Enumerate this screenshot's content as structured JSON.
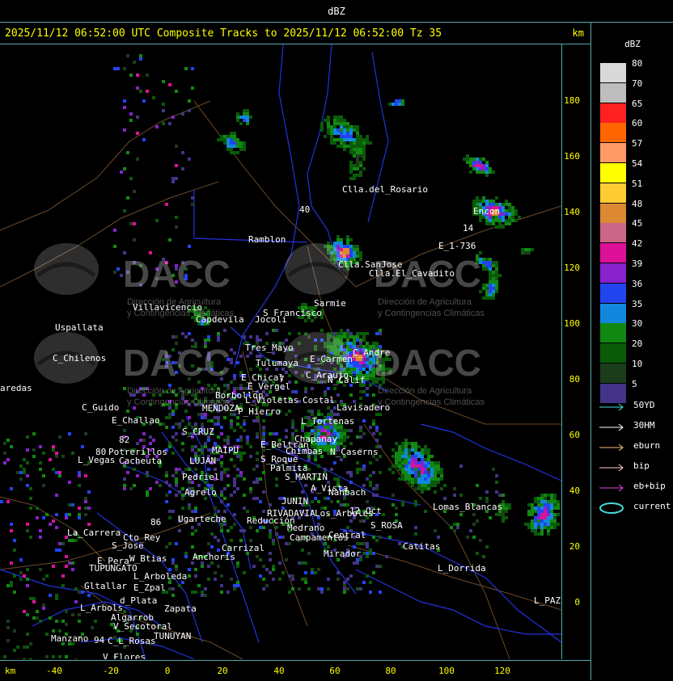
{
  "window": {
    "title": "dBZ"
  },
  "header": {
    "title": "2025/11/12 06:52:00 UTC Composite Tracks to 2025/11/12 06:52:00 Tz 35",
    "unit": "km"
  },
  "axes": {
    "x_unit": "km",
    "y_unit": "km",
    "x_ticks": [
      "-40",
      "-20",
      "0",
      "20",
      "40",
      "60",
      "80",
      "100",
      "120"
    ],
    "y_ticks": [
      "180",
      "160",
      "140",
      "120",
      "100",
      "80",
      "60",
      "40",
      "20",
      "0"
    ]
  },
  "legend": {
    "title": "dBZ",
    "levels": [
      {
        "label": "80",
        "color": "#d9d9d9"
      },
      {
        "label": "70",
        "color": "#bdbdbd"
      },
      {
        "label": "65",
        "color": "#ff2020"
      },
      {
        "label": "60",
        "color": "#ff6600"
      },
      {
        "label": "57",
        "color": "#ff9966"
      },
      {
        "label": "54",
        "color": "#ffff00"
      },
      {
        "label": "51",
        "color": "#ffcc33"
      },
      {
        "label": "48",
        "color": "#dd8833"
      },
      {
        "label": "45",
        "color": "#cc6688"
      },
      {
        "label": "42",
        "color": "#dd1199"
      },
      {
        "label": "39",
        "color": "#8822cc"
      },
      {
        "label": "36",
        "color": "#2244ee"
      },
      {
        "label": "35",
        "color": "#1188dd"
      },
      {
        "label": "30",
        "color": "#118811"
      },
      {
        "label": "20",
        "color": "#0a5a0a"
      },
      {
        "label": "10",
        "color": "#1c3d1c"
      },
      {
        "label": "5",
        "color": "#443388"
      }
    ]
  },
  "tracks": [
    {
      "label": "50YD",
      "color": "#44dddd",
      "kind": "arrow"
    },
    {
      "label": "30HM",
      "color": "#ffffff",
      "kind": "arrow"
    },
    {
      "label": "eburn",
      "color": "#eebb77",
      "kind": "arrow"
    },
    {
      "label": "bip",
      "color": "#ffcccc",
      "kind": "arrow"
    },
    {
      "label": "eb+bip",
      "color": "#dd44dd",
      "kind": "arrow"
    },
    {
      "label": "current",
      "color": "#44dddd",
      "kind": "ellipse"
    }
  ],
  "watermark": {
    "brand": "DACC",
    "line1": "Dirección de Agricultura",
    "line2": "y Contingencias Climáticas"
  },
  "places": [
    {
      "name": "Clla.del_Rosario"
    },
    {
      "name": "Ramblon"
    },
    {
      "name": "Encon"
    },
    {
      "name": "E_1-736"
    },
    {
      "name": "Clla.SanJose"
    },
    {
      "name": "Clla.El_Cavadito"
    },
    {
      "name": "Villavicencio"
    },
    {
      "name": "Uspallata"
    },
    {
      "name": "Capdevila"
    },
    {
      "name": "S_Francisco"
    },
    {
      "name": "Jocoli"
    },
    {
      "name": "Sarmie"
    },
    {
      "name": "Tres_Mayo"
    },
    {
      "name": "Tulumaya"
    },
    {
      "name": "C_Andre"
    },
    {
      "name": "E_Carmen"
    },
    {
      "name": "C_Chilenos"
    },
    {
      "name": "C_Araujo"
    },
    {
      "name": "N_Calif"
    },
    {
      "name": "E_Chical"
    },
    {
      "name": "E_Vergel"
    },
    {
      "name": "aredas"
    },
    {
      "name": "Borbollon"
    },
    {
      "name": "L_Violetas"
    },
    {
      "name": "Costal"
    },
    {
      "name": "Lavisadero"
    },
    {
      "name": "C_Guido"
    },
    {
      "name": "MENDOZA"
    },
    {
      "name": "P_Hierro"
    },
    {
      "name": "E_Challao"
    },
    {
      "name": "L_Tortenas"
    },
    {
      "name": "S_CRUZ"
    },
    {
      "name": "Chapanay"
    },
    {
      "name": "E_Beltran"
    },
    {
      "name": "MAIPU"
    },
    {
      "name": "Chimbas"
    },
    {
      "name": "N_Caserns"
    },
    {
      "name": "Potrerillos"
    },
    {
      "name": "L_Vegas"
    },
    {
      "name": "Cacheuta"
    },
    {
      "name": "LUJAN"
    },
    {
      "name": "S_Roque"
    },
    {
      "name": "Pedriel"
    },
    {
      "name": "Palmita"
    },
    {
      "name": "S_MARTIN"
    },
    {
      "name": "A_Vista"
    },
    {
      "name": "Nanbach"
    },
    {
      "name": "Agrelo"
    },
    {
      "name": "RIVADAVIA"
    },
    {
      "name": "JUNIN"
    },
    {
      "name": "Lomas_Blancas"
    },
    {
      "name": "Ugarteche"
    },
    {
      "name": "12_Oct"
    },
    {
      "name": "S_ROSA"
    },
    {
      "name": "Reducción"
    },
    {
      "name": "Medrano"
    },
    {
      "name": "Los_Arboles"
    },
    {
      "name": "La_Carrera"
    },
    {
      "name": "Cto_Rey"
    },
    {
      "name": "S_Jose"
    },
    {
      "name": "Campamentos"
    },
    {
      "name": "Central"
    },
    {
      "name": "Catitas"
    },
    {
      "name": "Carrizal"
    },
    {
      "name": "E_Pera"
    },
    {
      "name": "W_Btias"
    },
    {
      "name": "Anchoris"
    },
    {
      "name": "TUPUNGATO"
    },
    {
      "name": "Mirador"
    },
    {
      "name": "L_Dorrida"
    },
    {
      "name": "L_Arboleda"
    },
    {
      "name": "Gltallar"
    },
    {
      "name": "E_Zpal"
    },
    {
      "name": "d_Plata"
    },
    {
      "name": "L_Arbols"
    },
    {
      "name": "Zapata"
    },
    {
      "name": "L_PAZ"
    },
    {
      "name": "Algarrob"
    },
    {
      "name": "V_Secotoral"
    },
    {
      "name": "TUNUYAN"
    },
    {
      "name": "Manzano"
    },
    {
      "name": "C_L_Rosas"
    },
    {
      "name": "V_Flores"
    },
    {
      "name": "80"
    },
    {
      "name": "14"
    },
    {
      "name": "40"
    },
    {
      "name": "82"
    },
    {
      "name": "7"
    },
    {
      "name": "86"
    },
    {
      "name": "94"
    }
  ]
}
